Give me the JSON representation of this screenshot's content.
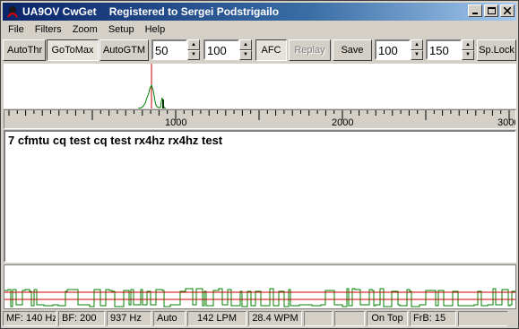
{
  "window": {
    "app_name": "UA9OV CwGet",
    "registration": "Registered to Sergei Podstrigailo"
  },
  "menu": [
    "File",
    "Filters",
    "Zoom",
    "Setup",
    "Help"
  ],
  "toolbar": {
    "autothr": "AutoThr",
    "gotomax": "GoToMax",
    "autogtm": "AutoGTM",
    "spin1": "50",
    "spin2": "100",
    "afc": "AFC",
    "replay": "Replay",
    "save": "Save",
    "spin3": "100",
    "spin4": "150",
    "splock": "Sp.Lock"
  },
  "ruler": {
    "labels": [
      "1000",
      "2000",
      "3000"
    ]
  },
  "decoded_text": "7 cfmtu cq test cq test rx4hz rx4hz test",
  "status": {
    "mf": "MF: 140 Hz",
    "bf": "BF: 200",
    "freq": "937 Hz",
    "mode": "Auto",
    "lpm": "142 LPM",
    "wpm": "28.4 WPM",
    "blank1": "",
    "blank2": "",
    "ontop": "On Top",
    "frb": "FrB: 15"
  },
  "colors": {
    "spectrum_marker": "#cc0000",
    "spectrum_trace": "#008000",
    "wave_trace": "#008000",
    "threshold_lines": "#cc0000"
  }
}
